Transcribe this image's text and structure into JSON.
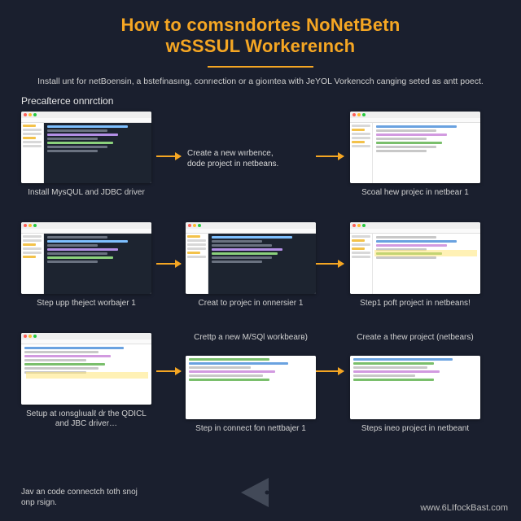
{
  "title_line1": "How to comsndortes NoNetBetn",
  "title_line2": "wSSSUL Workereınch",
  "intro": "Install unt for netBoensin, a bstefinasıng, conrıection or a gioınteа with JeYOL Vorkencch canging seted as antt poect.",
  "section_label": "Precaſterce onnrction",
  "row1": {
    "left_caption": "Install MysQUL and JDBC driver",
    "mid_line1": "Create a new wırbence,",
    "mid_line2": "dode project in netbeans.",
    "right_caption": "Scoal hew projec in netbear 1"
  },
  "row2": {
    "left_caption": "Step upp theject worbajer 1",
    "mid_caption": "Creat to projec in onnersier 1",
    "right_caption": "Step1 poft project in netbeans!"
  },
  "row3": {
    "left_caption": "Setup at ıonsglıualℓ dr the QDICL and JBC driver…",
    "mid_top": "Crettp a new M/SQl workbearв)",
    "mid_caption": "Step in connect fon nettbajer 1",
    "right_top": "Create a thew project (netbears)",
    "right_caption": "Steps ineo project in netbeant"
  },
  "bottom_note": "Jav an code connectch toth snoj onp rsign.",
  "site": "www.6LIfockBast.com"
}
